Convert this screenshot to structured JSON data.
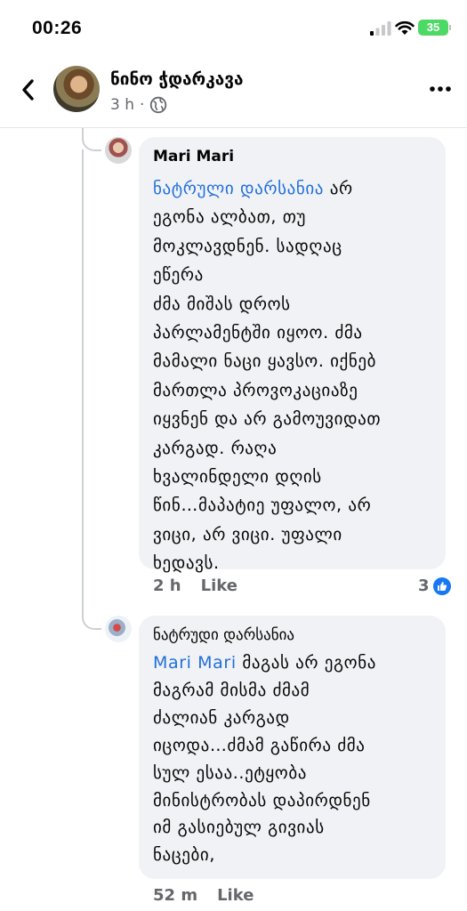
{
  "status_bar": {
    "time": "00:26",
    "battery": "35"
  },
  "post_header": {
    "author": "ნინო ჭდარკავა",
    "time_ago": "3 h",
    "separator": "·"
  },
  "comments": [
    {
      "author": "Mari Mari",
      "mention": "ნატრული დარსანია",
      "text": " არ\nეგონა ალბათ, თუ\nმოკლავდნენ. სადღაც\nეწერა\nძმა მიშას დროს\nპარლამენტში იყოო. ძმა\nმამალი ნაცი ყავსო.  იქნებ\nმართლა პროვოკაციაზე\nიყვნენ და არ გამოუვიდათ\nკარგად. რაღა\nხვალინდელი დღის\nწინ…მაპატიე უფალო, არ\nვიცი, არ ვიცი. უფალი\nხედავს.",
      "time_ago": "2 h",
      "like_label": "Like",
      "reaction_count": "3"
    },
    {
      "author": "ნატრუდი დარსანია",
      "mention": "Mari Mari",
      "text": " მაგას არ ეგონა\nმაგრამ მისმა ძმამ\nძალიან კარგად\nიცოდა…ძმამ გაწირა ძმა\nსულ ესაა..ეტყობა\nმინისტრობას დაპირდნენ\nიმ გასიებულ გივიას\nნაცები,",
      "time_ago": "52 m",
      "like_label": "Like"
    }
  ],
  "icons": {
    "back": "chevron-left-icon",
    "globe": "globe-icon",
    "more": "more-horizontal-icon",
    "like_reaction": "thumbs-up-icon"
  },
  "colors": {
    "mention": "#216fdb",
    "like_blue": "#1877f2",
    "bubble": "#f0f2f5"
  }
}
